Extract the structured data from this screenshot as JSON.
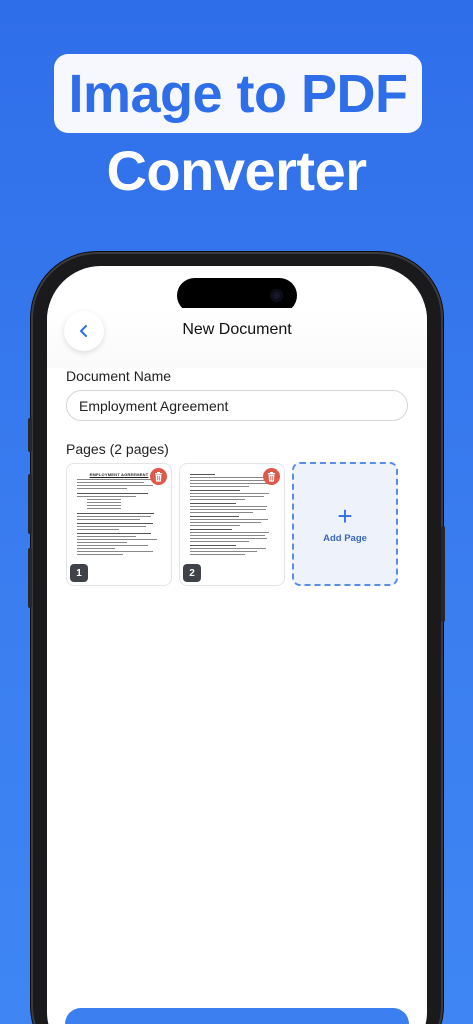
{
  "hero": {
    "title": "Image to PDF",
    "subtitle": "Converter"
  },
  "header": {
    "title": "New Document",
    "back_icon": "chevron-left-icon"
  },
  "document_name": {
    "label": "Document Name",
    "value": "Employment Agreement"
  },
  "pages": {
    "label": "Pages (2 pages)",
    "items": [
      {
        "number": "1",
        "heading": "EMPLOYMENT AGREEMENT"
      },
      {
        "number": "2",
        "heading": ""
      }
    ],
    "add_label": "Add Page"
  },
  "bottom_button": {
    "label": ""
  },
  "colors": {
    "accent": "#2f6ee9",
    "delete": "#e0584a",
    "badge": "#3f4248"
  }
}
